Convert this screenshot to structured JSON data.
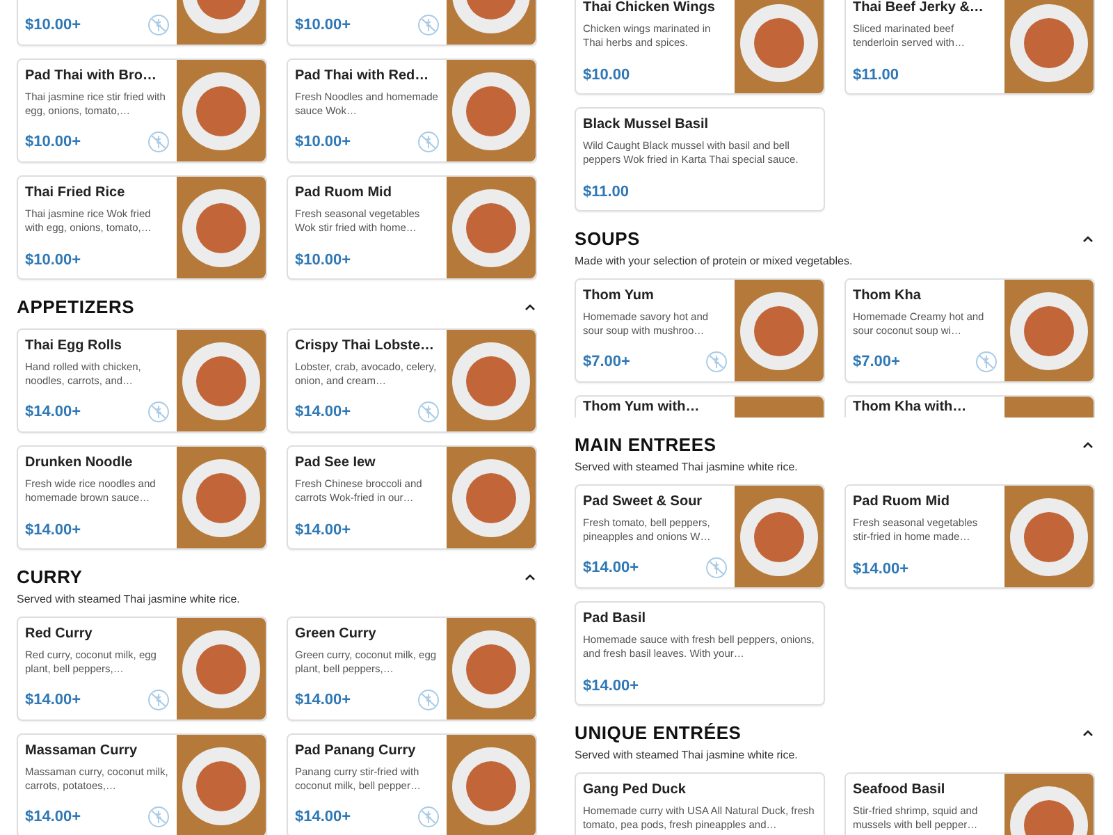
{
  "columns": [
    {
      "sections": [
        {
          "items": [
            {
              "kind": "photo",
              "price": "$10.00+",
              "no_sign": true
            },
            {
              "kind": "photo",
              "price": "$10.00+",
              "no_sign": true
            },
            {
              "kind": "photo",
              "name": "Pad Thai with Bro…",
              "description": "Thai jasmine rice stir fried with egg, onions, tomato,…",
              "price": "$10.00+",
              "no_sign": true
            },
            {
              "kind": "photo",
              "name": "Pad Thai with Red…",
              "description": "Fresh Noodles and homemade sauce Wok…",
              "price": "$10.00+",
              "no_sign": true
            },
            {
              "kind": "photo",
              "name": "Thai Fried Rice",
              "description": "Thai jasmine rice Wok fried with egg, onions, tomato,…",
              "price": "$10.00+",
              "no_sign": false
            },
            {
              "kind": "photo",
              "name": "Pad Ruom Mid",
              "description": "Fresh seasonal vegetables Wok stir fried with home…",
              "price": "$10.00+",
              "no_sign": false
            }
          ]
        },
        {
          "title": "APPETIZERS",
          "collapsed": false,
          "items": [
            {
              "kind": "photo",
              "name": "Thai Egg Rolls",
              "description": "Hand rolled with chicken, noodles, carrots, and…",
              "price": "$14.00+",
              "no_sign": true
            },
            {
              "kind": "photo",
              "name": "Crispy Thai Lobste…",
              "description": "Lobster, crab, avocado, celery, onion, and cream…",
              "price": "$14.00+",
              "no_sign": true
            },
            {
              "kind": "photo",
              "name": "Drunken Noodle",
              "description": "Fresh wide rice noodles and homemade brown sauce…",
              "price": "$14.00+",
              "no_sign": false
            },
            {
              "kind": "photo",
              "name": "Pad See Iew",
              "description": "Fresh Chinese broccoli and carrots Wok-fried in our…",
              "price": "$14.00+",
              "no_sign": false
            }
          ]
        },
        {
          "title": "CURRY",
          "subtitle": "Served with steamed Thai jasmine white rice.",
          "collapsed": false,
          "items": [
            {
              "kind": "photo",
              "name": "Red Curry",
              "description": "Red curry, coconut milk, egg plant, bell peppers,…",
              "price": "$14.00+",
              "no_sign": true
            },
            {
              "kind": "photo",
              "name": "Green Curry",
              "description": "Green curry, coconut milk, egg plant, bell peppers,…",
              "price": "$14.00+",
              "no_sign": true
            },
            {
              "kind": "photo",
              "name": "Massaman Curry",
              "description": "Massaman curry, coconut milk, carrots, potatoes,…",
              "price": "$14.00+",
              "no_sign": true
            },
            {
              "kind": "photo",
              "name": "Pad Panang Curry",
              "description": "Panang curry stir-fried with coconut milk, bell pepper…",
              "price": "$14.00+",
              "no_sign": true
            }
          ]
        }
      ]
    },
    {
      "sections": [
        {
          "items": [
            {
              "kind": "photo",
              "name": "Thai Chicken Wings",
              "description": "Chicken wings marinated in Thai herbs and spices.",
              "price": "$10.00",
              "no_sign": false
            },
            {
              "kind": "photo",
              "name": "Thai Beef Jerky &…",
              "description": "Sliced marinated beef tenderloin served with…",
              "price": "$11.00",
              "no_sign": false
            },
            {
              "kind": "plain",
              "name": "Black Mussel Basil",
              "description": "Wild Caught Black mussel with basil and bell peppers Wok fried in Karta Thai special sauce.",
              "price": "$11.00",
              "no_sign": false
            }
          ]
        },
        {
          "title": "SOUPS",
          "subtitle": "Made with your selection of protein or mixed vegetables.",
          "collapsed": false,
          "items": [
            {
              "kind": "photo",
              "name": "Thom Yum",
              "description": "Homemade savory hot and sour soup with mushroo…",
              "price": "$7.00+",
              "no_sign": true
            },
            {
              "kind": "photo",
              "name": "Thom Kha",
              "description": "Homemade Creamy hot and sour coconut soup wi…",
              "price": "$7.00+",
              "no_sign": true
            },
            {
              "kind": "partial",
              "name": "Thom Yum with…"
            },
            {
              "kind": "partial",
              "name": "Thom Kha with…"
            }
          ]
        },
        {
          "title": "MAIN ENTREES",
          "subtitle": "Served with steamed Thai jasmine white rice.",
          "collapsed": false,
          "items": [
            {
              "kind": "photo",
              "name": "Pad Sweet & Sour",
              "description": "Fresh tomato, bell peppers, pineapples and onions W…",
              "price": "$14.00+",
              "no_sign": true
            },
            {
              "kind": "photo",
              "name": "Pad Ruom Mid",
              "description": "Fresh seasonal vegetables stir-fried in home made…",
              "price": "$14.00+",
              "no_sign": false
            },
            {
              "kind": "plain",
              "name": "Pad Basil",
              "description": "Homemade sauce with fresh bell peppers, onions, and fresh basil leaves. With your…",
              "price": "$14.00+",
              "no_sign": false
            }
          ]
        },
        {
          "title": "UNIQUE ENTRÉES",
          "subtitle": "Served with steamed Thai jasmine white rice.",
          "collapsed": false,
          "items": [
            {
              "kind": "plain",
              "name": "Gang Ped  Duck",
              "description": "Homemade curry with USA All Natural Duck, fresh tomato, pea pods, fresh pineapples and…"
            },
            {
              "kind": "photo",
              "name": "Seafood Basil",
              "description": "Stir-fried shrimp, squid and mussels with bell pepper…"
            }
          ]
        }
      ]
    }
  ]
}
